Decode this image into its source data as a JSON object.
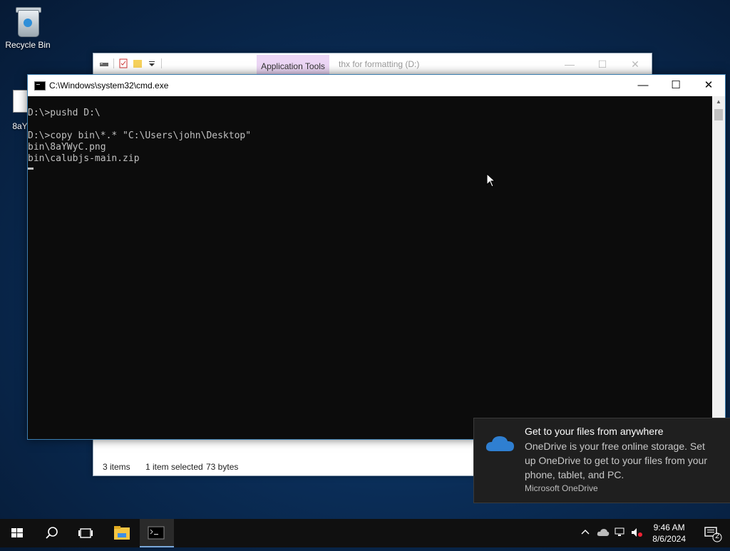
{
  "desktop": {
    "icons": [
      {
        "label": "Recycle Bin"
      },
      {
        "label": "8aY"
      }
    ]
  },
  "explorer": {
    "app_tools_label": "Application Tools",
    "title": "thx for formatting (D:)",
    "status": {
      "items": "3 items",
      "selected": "1 item selected",
      "size": "73 bytes"
    }
  },
  "cmd": {
    "title": "C:\\Windows\\system32\\cmd.exe",
    "lines": [
      "",
      "D:\\>pushd D:\\",
      "",
      "D:\\>copy bin\\*.* \"C:\\Users\\john\\Desktop\"",
      "bin\\8aYWyC.png",
      "bin\\calubjs-main.zip"
    ]
  },
  "toast": {
    "title": "Get to your files from anywhere",
    "body": "OneDrive is your free online storage. Set up OneDrive to get to your files from your phone, tablet, and PC.",
    "source": "Microsoft OneDrive"
  },
  "taskbar": {
    "time": "9:46 AM",
    "date": "8/6/2024",
    "notification_count": "2"
  },
  "colors": {
    "onedrive_cloud": "#2f7fd1",
    "app_tools_tab": "#ecd6f5"
  }
}
